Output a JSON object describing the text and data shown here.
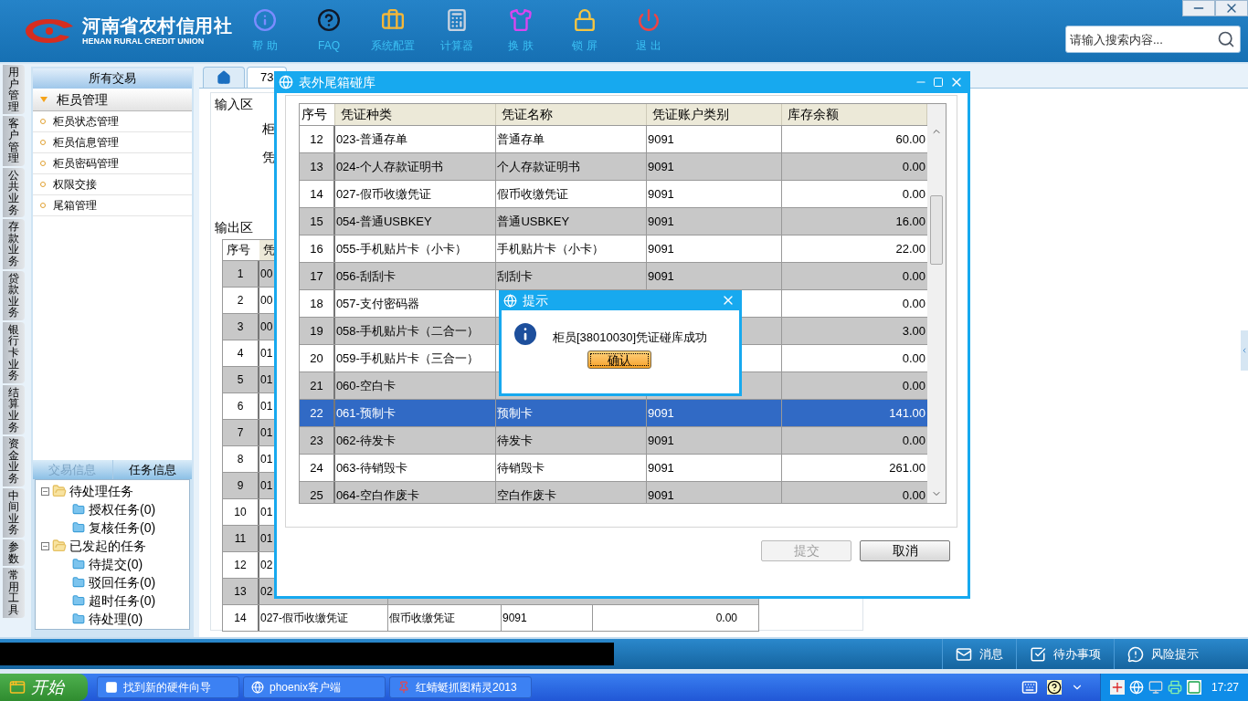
{
  "header": {
    "logo_title": "河南省农村信用社",
    "logo_subtitle": "HENAN RURAL CREDIT UNION",
    "toolbar": [
      {
        "kind": "help",
        "label": "帮 助"
      },
      {
        "kind": "faq",
        "label": "FAQ"
      },
      {
        "kind": "config",
        "label": "系统配置"
      },
      {
        "kind": "calculator",
        "label": "计算器"
      },
      {
        "kind": "skin",
        "label": "换 肤"
      },
      {
        "kind": "lock",
        "label": "锁 屏"
      },
      {
        "kind": "exit",
        "label": "退 出"
      }
    ],
    "search": {
      "placeholder": "请输入搜索内容..."
    }
  },
  "side_tabs": [
    {
      "label": "用户管理"
    },
    {
      "label": "客户管理"
    },
    {
      "label": "公共业务"
    },
    {
      "label": "存款业务"
    },
    {
      "label": "贷款业务"
    },
    {
      "label": "银行卡业务"
    },
    {
      "label": "结算业务"
    },
    {
      "label": "资金业务"
    },
    {
      "label": "中间业务"
    },
    {
      "label": "参数"
    },
    {
      "label": "常用工具"
    }
  ],
  "nav_panel": {
    "title": "所有交易",
    "group": {
      "label": "柜员管理",
      "expanded": true,
      "items": [
        "柜员状态管理",
        "柜员信息管理",
        "柜员密码管理",
        "权限交接",
        "尾箱管理"
      ]
    }
  },
  "info_panel": {
    "tabs": [
      {
        "label": "交易信息",
        "selected": false
      },
      {
        "label": "任务信息",
        "selected": true
      }
    ],
    "tree": [
      {
        "label": "待处理任务",
        "expanded": true,
        "children": [
          {
            "label": "授权任务(0)"
          },
          {
            "label": "复核任务(0)"
          }
        ]
      },
      {
        "label": "已发起的任务",
        "expanded": true,
        "children": [
          {
            "label": "待提交(0)"
          },
          {
            "label": "驳回任务(0)"
          },
          {
            "label": "超时任务(0)"
          },
          {
            "label": "待处理(0)"
          }
        ]
      }
    ]
  },
  "content_tabs": [
    {
      "kind": "home",
      "selected": false
    },
    {
      "kind": "text",
      "label": "73",
      "selected": true
    }
  ],
  "form": {
    "input_legend": "输入区",
    "input_labels": [
      "柜",
      "凭"
    ],
    "output_legend": "输出区",
    "table": {
      "columns": [
        "序号",
        "凭"
      ],
      "rows": [
        {
          "seq": "1",
          "column_2": "00"
        },
        {
          "seq": "2",
          "column_2": "00"
        },
        {
          "seq": "3",
          "column_2": "00"
        },
        {
          "seq": "4",
          "column_2": "01"
        },
        {
          "seq": "5",
          "column_2": "01"
        },
        {
          "seq": "6",
          "column_2": "01"
        },
        {
          "seq": "7",
          "column_2": "01"
        },
        {
          "seq": "8",
          "column_2": "01"
        },
        {
          "seq": "9",
          "column_2": "01"
        },
        {
          "seq": "10",
          "column_2": "01"
        },
        {
          "seq": "11",
          "column_2": "01"
        },
        {
          "seq": "12",
          "column_2": "02"
        },
        {
          "seq": "13",
          "column_2": "02"
        },
        {
          "seq": "14",
          "column_2": "027-假币收缴凭证",
          "column_3": "假币收缴凭证",
          "column_4": "9091",
          "column_5": "0.00"
        }
      ]
    }
  },
  "dialog": {
    "title": "表外尾箱碰库",
    "table": {
      "columns": [
        "序号",
        "凭证种类",
        "凭证名称",
        "凭证账户类别",
        "库存余额"
      ],
      "rows": [
        {
          "seq": "12",
          "type": "023-普通存单",
          "name": "普通存单",
          "account": "9091",
          "balance": "60.00",
          "selected": false
        },
        {
          "seq": "13",
          "type": "024-个人存款证明书",
          "name": "个人存款证明书",
          "account": "9091",
          "balance": "0.00",
          "selected": false
        },
        {
          "seq": "14",
          "type": "027-假币收缴凭证",
          "name": "假币收缴凭证",
          "account": "9091",
          "balance": "0.00",
          "selected": false
        },
        {
          "seq": "15",
          "type": "054-普通USBKEY",
          "name": "普通USBKEY",
          "account": "9091",
          "balance": "16.00",
          "selected": false
        },
        {
          "seq": "16",
          "type": "055-手机贴片卡（小卡）",
          "name": "手机贴片卡（小卡）",
          "account": "9091",
          "balance": "22.00",
          "selected": false
        },
        {
          "seq": "17",
          "type": "056-刮刮卡",
          "name": "刮刮卡",
          "account": "9091",
          "balance": "0.00",
          "selected": false
        },
        {
          "seq": "18",
          "type": "057-支付密码器",
          "balance": "0.00",
          "selected": false
        },
        {
          "seq": "19",
          "type": "058-手机贴片卡（二合一）",
          "balance": "3.00",
          "selected": false
        },
        {
          "seq": "20",
          "type": "059-手机贴片卡（三合一）",
          "balance": "0.00",
          "selected": false
        },
        {
          "seq": "21",
          "type": "060-空白卡",
          "balance": "0.00",
          "selected": false
        },
        {
          "seq": "22",
          "type": "061-预制卡",
          "name": "预制卡",
          "account": "9091",
          "balance": "141.00",
          "selected": true
        },
        {
          "seq": "23",
          "type": "062-待发卡",
          "name": "待发卡",
          "account": "9091",
          "balance": "0.00",
          "selected": false
        },
        {
          "seq": "24",
          "type": "063-待销毁卡",
          "name": "待销毁卡",
          "account": "9091",
          "balance": "261.00",
          "selected": false
        },
        {
          "seq": "25",
          "type": "064-空白作废卡",
          "name": "空白作废卡",
          "account": "9091",
          "balance": "0.00",
          "selected": false
        }
      ]
    },
    "buttons": [
      {
        "label": "提交",
        "disabled": true
      },
      {
        "label": "取消",
        "disabled": false
      }
    ]
  },
  "prompt": {
    "title": "提示",
    "message": "柜员[38010030]凭证碰库成功",
    "button": "确认"
  },
  "status_bar": [
    {
      "kind": "message",
      "label": "消息"
    },
    {
      "kind": "todo",
      "label": "待办事项"
    },
    {
      "kind": "risk",
      "label": "风险提示"
    }
  ],
  "taskbar": {
    "start": "开始",
    "tasks": [
      {
        "kind": "window",
        "label": "找到新的硬件向导"
      },
      {
        "kind": "browser",
        "label": "phoenix客户端"
      },
      {
        "kind": "app",
        "label": "红蜻蜓抓图精灵2013"
      }
    ],
    "clock": "17:27"
  }
}
